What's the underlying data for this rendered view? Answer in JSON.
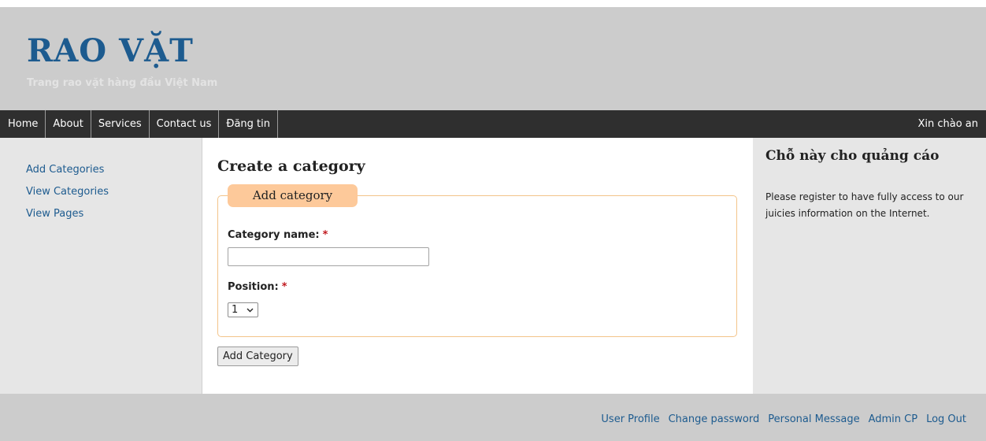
{
  "header": {
    "site_title": "RAO VẶT",
    "tagline": "Trang rao vặt hàng đầu Việt Nam"
  },
  "nav": {
    "items": [
      {
        "label": "Home"
      },
      {
        "label": "About"
      },
      {
        "label": "Services"
      },
      {
        "label": "Contact us"
      },
      {
        "label": "Đăng tin"
      }
    ],
    "greeting": "Xin chào an"
  },
  "sidebar": {
    "links": [
      {
        "label": "Add Categories"
      },
      {
        "label": "View Categories"
      },
      {
        "label": "View Pages"
      }
    ]
  },
  "main": {
    "heading": "Create a category",
    "fieldset_legend": "Add category",
    "category_name_label": "Category name:",
    "category_name_value": "",
    "required_marker": "*",
    "position_label": "Position:",
    "position_value": "1",
    "submit_label": "Add Category"
  },
  "ad": {
    "heading": "Chỗ này cho quảng cáo",
    "text": "Please register to have fully access to our juicies information on the Internet."
  },
  "footer": {
    "links": [
      {
        "label": "User Profile"
      },
      {
        "label": "Change password"
      },
      {
        "label": "Personal Message"
      },
      {
        "label": "Admin CP"
      },
      {
        "label": "Log Out"
      }
    ]
  },
  "colors": {
    "header_bg": "#cccccc",
    "nav_bg": "#2f2f2f",
    "link": "#1d5b8f",
    "legend_bg": "#fdc99a",
    "fieldset_border": "#f3c48a",
    "required": "#c0181e"
  },
  "icons": {
    "select_chevron": "chevron-down-icon"
  }
}
